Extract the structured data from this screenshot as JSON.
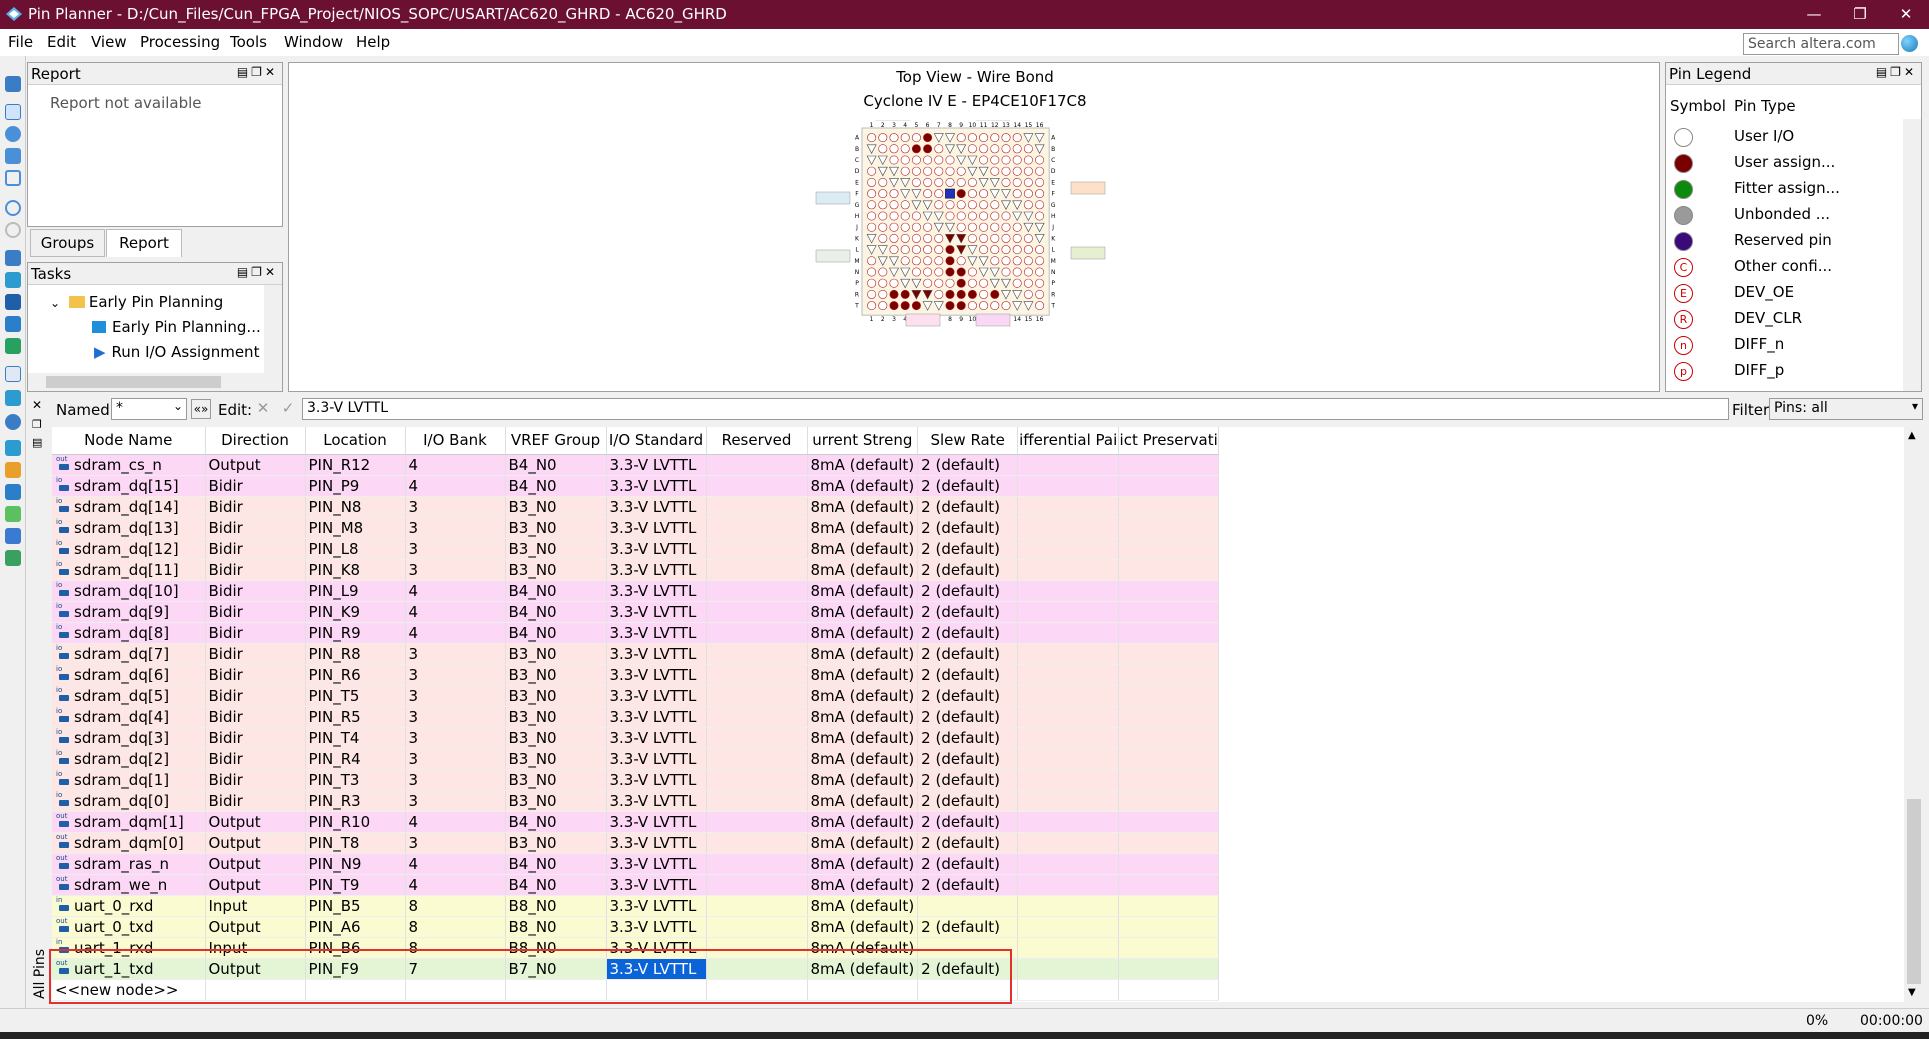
{
  "window": {
    "title": "Pin Planner - D:/Cun_Files/Cun_FPGA_Project/NIOS_SOPC/USART/AC620_GHRD - AC620_GHRD"
  },
  "menu": [
    "File",
    "Edit",
    "View",
    "Processing",
    "Tools",
    "Window",
    "Help"
  ],
  "search": {
    "placeholder": "Search altera.com"
  },
  "report": {
    "title": "Report",
    "message": "Report not available",
    "tabs": [
      "Groups",
      "Report"
    ]
  },
  "tasks": {
    "title": "Tasks",
    "items": [
      "Early Pin Planning",
      "Early Pin Planning...",
      "Run I/O Assignment A"
    ]
  },
  "package": {
    "title": "Top View - Wire Bond",
    "device": "Cyclone IV E - EP4CE10F17C8",
    "cols": [
      "1",
      "2",
      "3",
      "4",
      "5",
      "6",
      "7",
      "8",
      "9",
      "10",
      "11",
      "12",
      "13",
      "14",
      "15",
      "16"
    ],
    "rows": [
      "A",
      "B",
      "C",
      "D",
      "E",
      "F",
      "G",
      "H",
      "J",
      "K",
      "L",
      "M",
      "N",
      "P",
      "R",
      "T"
    ]
  },
  "legend": {
    "title": "Pin Legend",
    "headers": [
      "Symbol",
      "Pin Type"
    ],
    "items": [
      {
        "label": "User I/O",
        "color": "#ffffff",
        "glyph": ""
      },
      {
        "label": "User assign...",
        "color": "#7a0000",
        "glyph": ""
      },
      {
        "label": "Fitter assign...",
        "color": "#0b8a0b",
        "glyph": ""
      },
      {
        "label": "Unbonded ...",
        "color": "#9a9a9a",
        "glyph": ""
      },
      {
        "label": "Reserved pin",
        "color": "#3a0a7a",
        "glyph": ""
      },
      {
        "label": "Other confi...",
        "color": "#ffffff",
        "glyph": "C"
      },
      {
        "label": "DEV_OE",
        "color": "#ffffff",
        "glyph": "E"
      },
      {
        "label": "DEV_CLR",
        "color": "#ffffff",
        "glyph": "R"
      },
      {
        "label": "DIFF_n",
        "color": "#ffffff",
        "glyph": "n"
      },
      {
        "label": "DIFF_p",
        "color": "#ffffff",
        "glyph": "p"
      }
    ]
  },
  "filterbar": {
    "named_label": "Named:",
    "named_value": "*",
    "edit_label": "Edit:",
    "edit_value": "3.3-V LVTTL",
    "filter_label": "Filter:",
    "filter_value": "Pins: all"
  },
  "table": {
    "headers": [
      "Node Name",
      "Direction",
      "Location",
      "I/O Bank",
      "VREF Group",
      "I/O Standard",
      "Reserved",
      "urrent Streng",
      "Slew Rate",
      "ifferential Pai",
      "ict Preservati"
    ],
    "rows": [
      {
        "io": "out",
        "name": "sdram_cs_n",
        "dir": "Output",
        "loc": "PIN_R12",
        "bank": "4",
        "vref": "B4_N0",
        "std": "3.3-V LVTTL",
        "cur": "8mA (default)",
        "slew": "2 (default)",
        "color": "pink"
      },
      {
        "io": "io",
        "name": "sdram_dq[15]",
        "dir": "Bidir",
        "loc": "PIN_P9",
        "bank": "4",
        "vref": "B4_N0",
        "std": "3.3-V LVTTL",
        "cur": "8mA (default)",
        "slew": "2 (default)",
        "color": "pink"
      },
      {
        "io": "io",
        "name": "sdram_dq[14]",
        "dir": "Bidir",
        "loc": "PIN_N8",
        "bank": "3",
        "vref": "B3_N0",
        "std": "3.3-V LVTTL",
        "cur": "8mA (default)",
        "slew": "2 (default)",
        "color": "salmon"
      },
      {
        "io": "io",
        "name": "sdram_dq[13]",
        "dir": "Bidir",
        "loc": "PIN_M8",
        "bank": "3",
        "vref": "B3_N0",
        "std": "3.3-V LVTTL",
        "cur": "8mA (default)",
        "slew": "2 (default)",
        "color": "salmon"
      },
      {
        "io": "io",
        "name": "sdram_dq[12]",
        "dir": "Bidir",
        "loc": "PIN_L8",
        "bank": "3",
        "vref": "B3_N0",
        "std": "3.3-V LVTTL",
        "cur": "8mA (default)",
        "slew": "2 (default)",
        "color": "salmon"
      },
      {
        "io": "io",
        "name": "sdram_dq[11]",
        "dir": "Bidir",
        "loc": "PIN_K8",
        "bank": "3",
        "vref": "B3_N0",
        "std": "3.3-V LVTTL",
        "cur": "8mA (default)",
        "slew": "2 (default)",
        "color": "salmon"
      },
      {
        "io": "io",
        "name": "sdram_dq[10]",
        "dir": "Bidir",
        "loc": "PIN_L9",
        "bank": "4",
        "vref": "B4_N0",
        "std": "3.3-V LVTTL",
        "cur": "8mA (default)",
        "slew": "2 (default)",
        "color": "pink"
      },
      {
        "io": "io",
        "name": "sdram_dq[9]",
        "dir": "Bidir",
        "loc": "PIN_K9",
        "bank": "4",
        "vref": "B4_N0",
        "std": "3.3-V LVTTL",
        "cur": "8mA (default)",
        "slew": "2 (default)",
        "color": "pink"
      },
      {
        "io": "io",
        "name": "sdram_dq[8]",
        "dir": "Bidir",
        "loc": "PIN_R9",
        "bank": "4",
        "vref": "B4_N0",
        "std": "3.3-V LVTTL",
        "cur": "8mA (default)",
        "slew": "2 (default)",
        "color": "pink"
      },
      {
        "io": "io",
        "name": "sdram_dq[7]",
        "dir": "Bidir",
        "loc": "PIN_R8",
        "bank": "3",
        "vref": "B3_N0",
        "std": "3.3-V LVTTL",
        "cur": "8mA (default)",
        "slew": "2 (default)",
        "color": "salmon"
      },
      {
        "io": "io",
        "name": "sdram_dq[6]",
        "dir": "Bidir",
        "loc": "PIN_R6",
        "bank": "3",
        "vref": "B3_N0",
        "std": "3.3-V LVTTL",
        "cur": "8mA (default)",
        "slew": "2 (default)",
        "color": "salmon"
      },
      {
        "io": "io",
        "name": "sdram_dq[5]",
        "dir": "Bidir",
        "loc": "PIN_T5",
        "bank": "3",
        "vref": "B3_N0",
        "std": "3.3-V LVTTL",
        "cur": "8mA (default)",
        "slew": "2 (default)",
        "color": "salmon"
      },
      {
        "io": "io",
        "name": "sdram_dq[4]",
        "dir": "Bidir",
        "loc": "PIN_R5",
        "bank": "3",
        "vref": "B3_N0",
        "std": "3.3-V LVTTL",
        "cur": "8mA (default)",
        "slew": "2 (default)",
        "color": "salmon"
      },
      {
        "io": "io",
        "name": "sdram_dq[3]",
        "dir": "Bidir",
        "loc": "PIN_T4",
        "bank": "3",
        "vref": "B3_N0",
        "std": "3.3-V LVTTL",
        "cur": "8mA (default)",
        "slew": "2 (default)",
        "color": "salmon"
      },
      {
        "io": "io",
        "name": "sdram_dq[2]",
        "dir": "Bidir",
        "loc": "PIN_R4",
        "bank": "3",
        "vref": "B3_N0",
        "std": "3.3-V LVTTL",
        "cur": "8mA (default)",
        "slew": "2 (default)",
        "color": "salmon"
      },
      {
        "io": "io",
        "name": "sdram_dq[1]",
        "dir": "Bidir",
        "loc": "PIN_T3",
        "bank": "3",
        "vref": "B3_N0",
        "std": "3.3-V LVTTL",
        "cur": "8mA (default)",
        "slew": "2 (default)",
        "color": "salmon"
      },
      {
        "io": "io",
        "name": "sdram_dq[0]",
        "dir": "Bidir",
        "loc": "PIN_R3",
        "bank": "3",
        "vref": "B3_N0",
        "std": "3.3-V LVTTL",
        "cur": "8mA (default)",
        "slew": "2 (default)",
        "color": "salmon"
      },
      {
        "io": "out",
        "name": "sdram_dqm[1]",
        "dir": "Output",
        "loc": "PIN_R10",
        "bank": "4",
        "vref": "B4_N0",
        "std": "3.3-V LVTTL",
        "cur": "8mA (default)",
        "slew": "2 (default)",
        "color": "pink"
      },
      {
        "io": "out",
        "name": "sdram_dqm[0]",
        "dir": "Output",
        "loc": "PIN_T8",
        "bank": "3",
        "vref": "B3_N0",
        "std": "3.3-V LVTTL",
        "cur": "8mA (default)",
        "slew": "2 (default)",
        "color": "salmon"
      },
      {
        "io": "out",
        "name": "sdram_ras_n",
        "dir": "Output",
        "loc": "PIN_N9",
        "bank": "4",
        "vref": "B4_N0",
        "std": "3.3-V LVTTL",
        "cur": "8mA (default)",
        "slew": "2 (default)",
        "color": "pink"
      },
      {
        "io": "out",
        "name": "sdram_we_n",
        "dir": "Output",
        "loc": "PIN_T9",
        "bank": "4",
        "vref": "B4_N0",
        "std": "3.3-V LVTTL",
        "cur": "8mA (default)",
        "slew": "2 (default)",
        "color": "pink"
      },
      {
        "io": "in",
        "name": "uart_0_rxd",
        "dir": "Input",
        "loc": "PIN_B5",
        "bank": "8",
        "vref": "B8_N0",
        "std": "3.3-V LVTTL",
        "cur": "8mA (default)",
        "slew": "",
        "color": "yellow"
      },
      {
        "io": "out",
        "name": "uart_0_txd",
        "dir": "Output",
        "loc": "PIN_A6",
        "bank": "8",
        "vref": "B8_N0",
        "std": "3.3-V LVTTL",
        "cur": "8mA (default)",
        "slew": "2 (default)",
        "color": "yellow"
      },
      {
        "io": "in",
        "name": "uart_1_rxd",
        "dir": "Input",
        "loc": "PIN_B6",
        "bank": "8",
        "vref": "B8_N0",
        "std": "3.3-V LVTTL",
        "cur": "8mA (default)",
        "slew": "",
        "color": "yellow"
      },
      {
        "io": "out",
        "name": "uart_1_txd",
        "dir": "Output",
        "loc": "PIN_F9",
        "bank": "7",
        "vref": "B7_N0",
        "std": "3.3-V LVTTL",
        "cur": "8mA (default)",
        "slew": "2 (default)",
        "color": "green",
        "selected_col": "std"
      }
    ],
    "new_node": "<<new node>>"
  },
  "side_label": "All Pins",
  "status": {
    "progress": "0%",
    "time": "00:00:00"
  }
}
